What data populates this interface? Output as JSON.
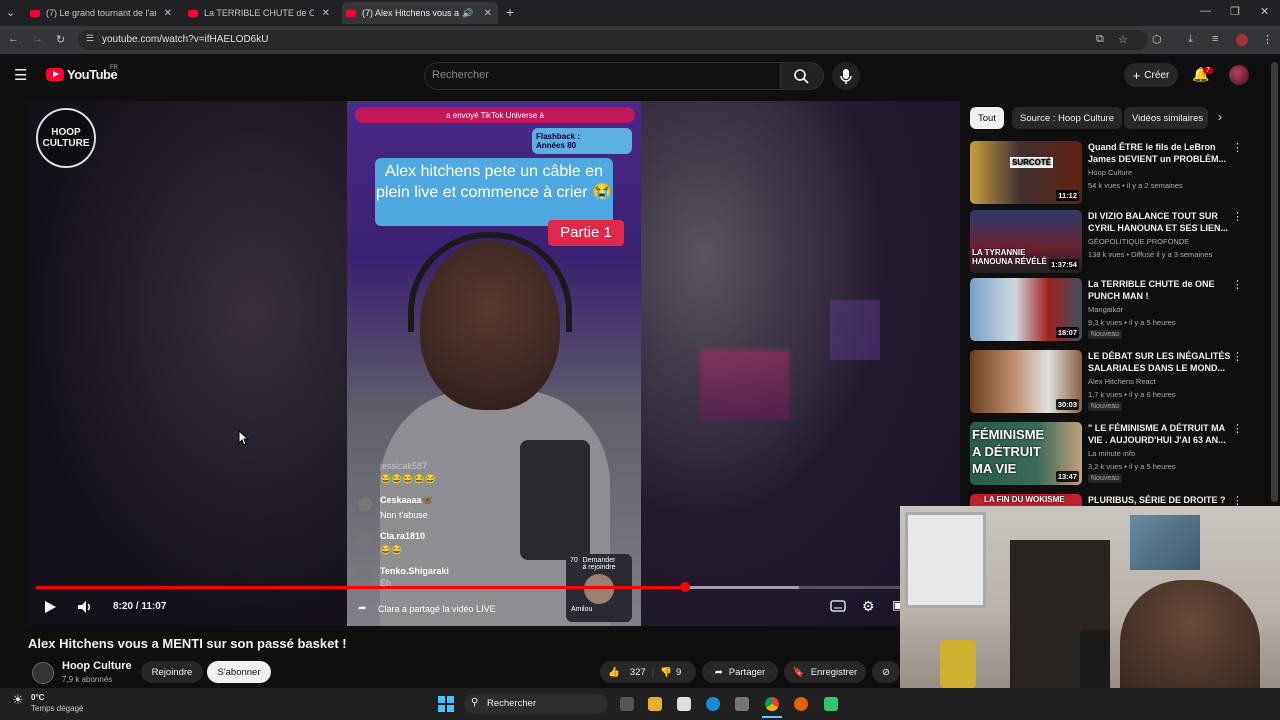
{
  "browser": {
    "tabs": [
      {
        "label": "(7) Le grand tournant de l'anim"
      },
      {
        "label": "La TERRIBLE CHUTE de ONE PU"
      },
      {
        "label": "(7) Alex Hitchens vous a ME"
      }
    ],
    "url": "youtube.com/watch?v=ifHAELOD6kU"
  },
  "header": {
    "logo": "YouTube",
    "logo_region": "FR",
    "search_placeholder": "Rechercher",
    "create_label": "Créer",
    "notif_count": "7"
  },
  "video": {
    "channel_watermark": [
      "HOOP",
      "CULTURE"
    ],
    "tiktok_banner": "a envoyé TikTok Universe à",
    "flashback": [
      "Flashback :",
      "Années 80"
    ],
    "caption": "Alex hitchens pete un câble en plein live et commence à crier 😭",
    "part_label": "Partie 1",
    "chat": [
      {
        "user": "jessicak587",
        "msg": "😂😂😂😂😂"
      },
      {
        "user": "Ceskaaaa🦋",
        "msg": "Non t'abuse"
      },
      {
        "user": "Cla.ra1810",
        "msg": "😂😂"
      },
      {
        "user": "Tenko.Shigaraki",
        "msg": "Eh"
      }
    ],
    "join_request": [
      "Demander",
      "à rejoindre"
    ],
    "guest_name": "Amilou",
    "guest_count": "70",
    "share_notice": "Clara a partagé la vidéo LIVE",
    "time": "8:20 / 11:07",
    "progress_fraction": 0.751,
    "buffer_fraction": 0.883
  },
  "meta": {
    "title": "Alex Hitchens vous a MENTI sur son passé basket !",
    "channel": "Hoop Culture",
    "subs": "7,9 k abonnés",
    "join_label": "Rejoindre",
    "subscribe_label": "S'abonner",
    "likes": "327",
    "dislikes": "9",
    "share_label": "Partager",
    "save_label": "Enregistrer"
  },
  "chips": [
    "Tout",
    "Source : Hoop Culture",
    "Vidéos similaires"
  ],
  "recommendations": [
    {
      "title": "Quand ÊTRE le fils de LeBron James DEVIENT un PROBLÈM...",
      "channel": "Hoop Culture",
      "meta": "54 k vues • il y a 2 semaines",
      "duration": "11:12",
      "thumb_text": "SURCOTÉ",
      "badge": ""
    },
    {
      "title": "DI VIZIO BALANCE TOUT SUR CYRIL HANOUNA ET SES LIEN...",
      "channel": "GÉOPOLITIQUE PROFONDE",
      "meta": "138 k vues • Diffusé il y a 3 semaines",
      "duration": "1:37:54",
      "thumb_text": "LA TYRANNIE HANOUNA RÉVÉLÉ",
      "badge": ""
    },
    {
      "title": "La TERRIBLE CHUTE de ONE PUNCH MAN !",
      "channel": "Mangaikor",
      "meta": "9,3 k vues • il y a 5 heures",
      "duration": "18:07",
      "thumb_text": "",
      "badge": "Nouveau"
    },
    {
      "title": "LE DÉBAT SUR LES INÉGALITÉS SALARIALES DANS LE MOND...",
      "channel": "Alex Hitchens React",
      "meta": "1,7 k vues • il y a 6 heures",
      "duration": "30:03",
      "thumb_text": "",
      "badge": "Nouveau"
    },
    {
      "title": "\" LE FÉMINISME A DÉTRUIT MA VIE . AUJOURD'HUI J'AI 63 AN...",
      "channel": "La minute info",
      "meta": "3,2 k vues • il y a 5 heures",
      "duration": "13:47",
      "thumb_text": "FÉMINISME A DÉTRUIT MA VIE",
      "badge": "Nouveau"
    },
    {
      "title": "PLURIBUS, SÉRIE DE DROITE ?",
      "channel": "",
      "meta": "",
      "duration": "",
      "thumb_text": "LA FIN DU WOKISME",
      "badge": ""
    }
  ],
  "taskbar": {
    "weather_temp": "0°C",
    "weather_desc": "Temps dégagé",
    "search_label": "Rechercher"
  },
  "colors": {
    "accent": "#ff0033",
    "caption_bg": "#4fa8e0",
    "part_bg": "#e0294a"
  }
}
